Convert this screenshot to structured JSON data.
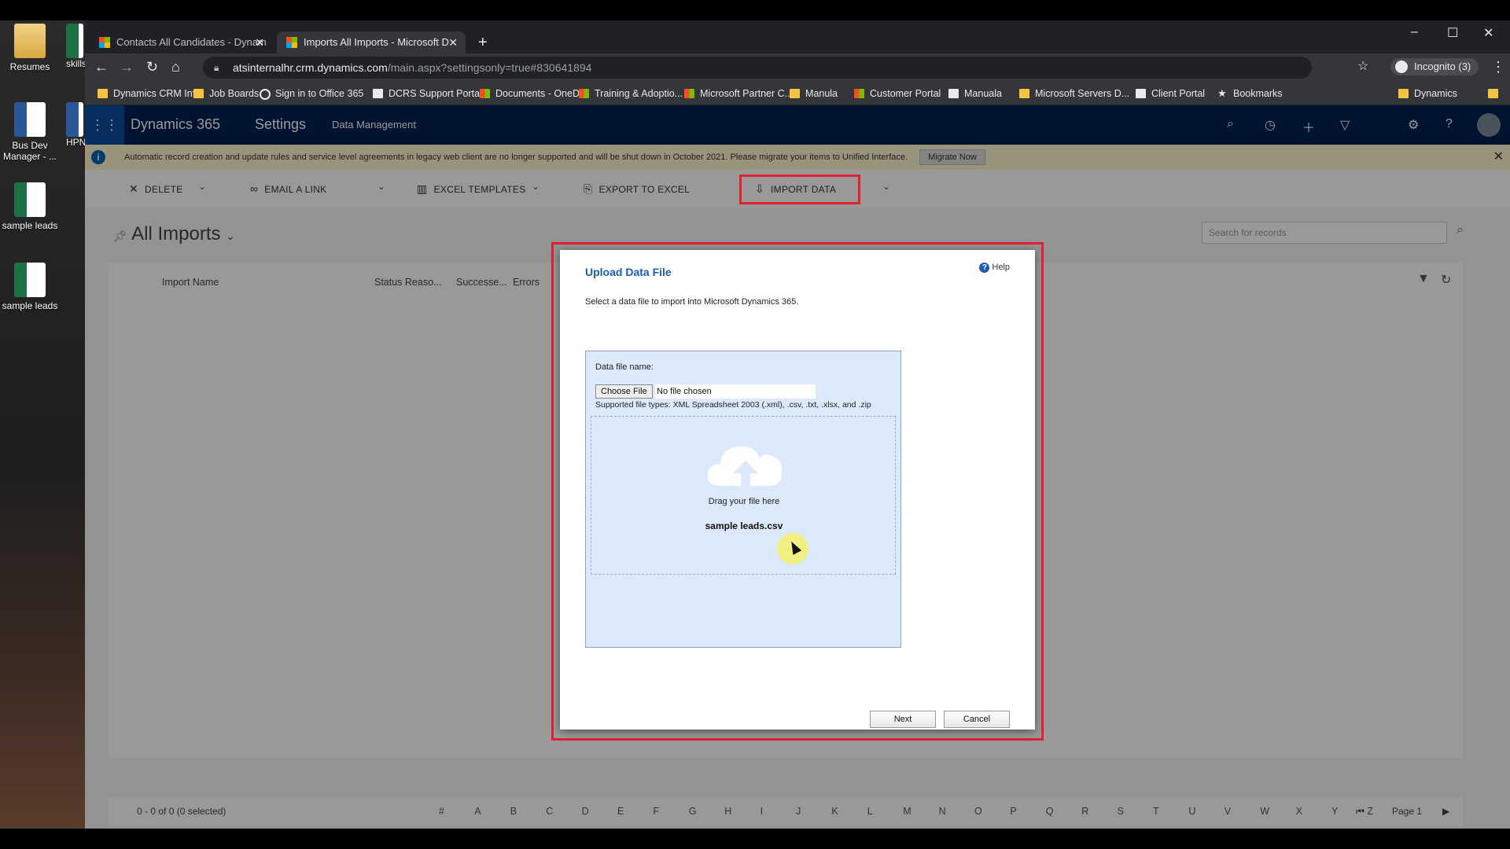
{
  "desktop": {
    "icons": [
      "Resumes",
      "skills",
      "Bus Dev Manager - ...",
      "HPN",
      "sample leads",
      "sample leads"
    ]
  },
  "browser": {
    "tabs": [
      {
        "label": "Contacts All Candidates - Dynam"
      },
      {
        "label": "Imports All Imports - Microsoft D"
      }
    ],
    "new_tab": "+",
    "window_controls": {
      "minimize": "–",
      "maximize": "☐",
      "close": "✕"
    },
    "url_host": "atsinternalhr.crm.dynamics.com",
    "url_path": "/main.aspx?settingsonly=true#830641894",
    "profile": "Incognito (3)",
    "bookmarks": [
      "Dynamics CRM Info",
      "Job Boards",
      "Sign in to Office 365",
      "DCRS Support Portal",
      "Documents - OneD...",
      "Training & Adoptio...",
      "Microsoft Partner C...",
      "Manula",
      "Customer Portal",
      "Manuala",
      "Microsoft Servers D...",
      "Client Portal",
      "Bookmarks",
      "Dynamics"
    ],
    "more_bookmarks": "»"
  },
  "crm": {
    "app": "Dynamics 365",
    "area": "Settings",
    "sub_area": "Data Management",
    "banner_text": "Automatic record creation and update rules and service level agreements in legacy web client are no longer supported and will be shut down in October 2021. Please migrate your items to Unified Interface.",
    "migrate_label": "Migrate Now",
    "commands": [
      "DELETE",
      "EMAIL A LINK",
      "EXCEL TEMPLATES",
      "EXPORT TO EXCEL",
      "IMPORT DATA"
    ],
    "view_title": "All Imports",
    "search_placeholder": "Search for records",
    "columns": [
      "Import Name",
      "Status Reaso...",
      "Successe...",
      "Errors"
    ],
    "record_count": "0 - 0 of 0 (0 selected)",
    "alphabet": [
      "#",
      "A",
      "B",
      "C",
      "D",
      "E",
      "F",
      "G",
      "H",
      "I",
      "J",
      "K",
      "L",
      "M",
      "N",
      "O",
      "P",
      "Q",
      "R",
      "S",
      "T",
      "U",
      "V",
      "W",
      "X",
      "Y",
      "Z"
    ],
    "page_label": "Page 1"
  },
  "dialog": {
    "title": "Upload Data File",
    "help": "Help",
    "description": "Select a data file to import into Microsoft Dynamics 365.",
    "file_label": "Data file name:",
    "choose_file": "Choose File",
    "no_file": "No file chosen",
    "supported": "Supported file types: XML Spreadsheet 2003 (.xml), .csv, .txt, .xlsx, and .zip",
    "drag_text": "Drag your file here",
    "dropped_file": "sample leads.csv",
    "next": "Next",
    "cancel": "Cancel"
  },
  "colors": {
    "highlight": "#e2202e",
    "d365_nav": "#002050",
    "dialog_title": "#1b5cb3",
    "upload_bg": "#dce9fa"
  }
}
